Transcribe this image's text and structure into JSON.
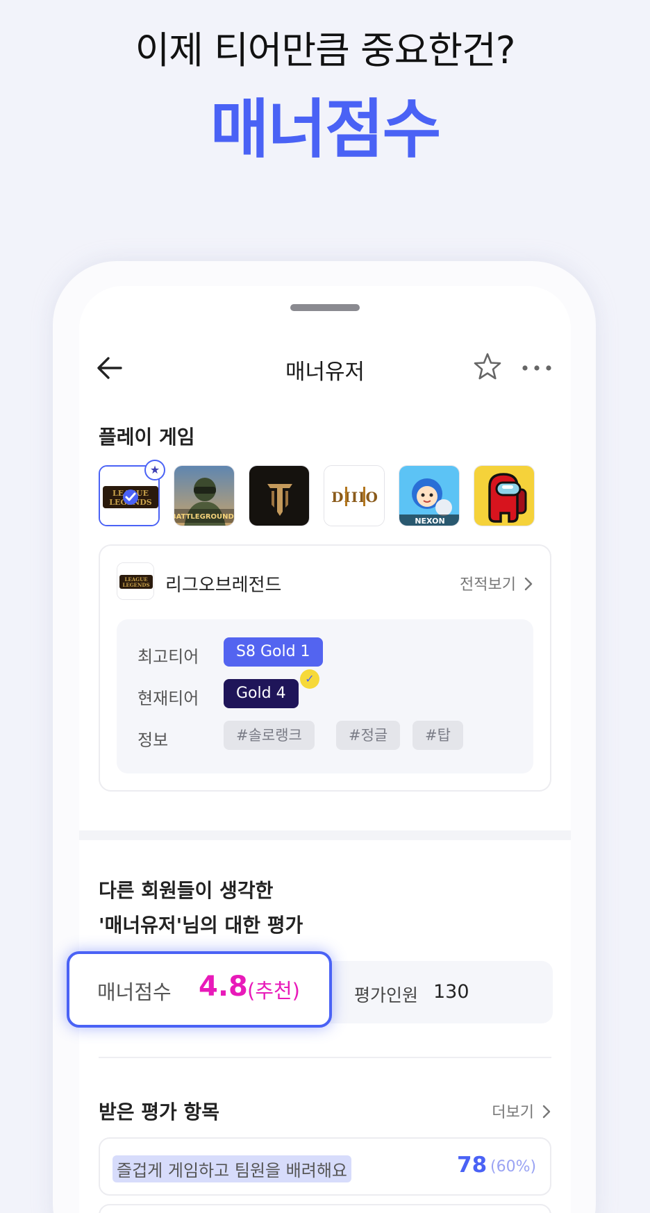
{
  "headline": "이제 티어만큼 중요한건?",
  "hero": "매너점수",
  "topbar": {
    "title": "매너유저"
  },
  "play_games": {
    "label": "플레이 게임",
    "games": [
      {
        "name": "League of Legends",
        "selected": true,
        "favorite": true
      },
      {
        "name": "PUBG: BATTLEGROUNDS"
      },
      {
        "name": "Lineage"
      },
      {
        "name": "Diablo II"
      },
      {
        "name": "Crazy Arcade (NEXON)"
      },
      {
        "name": "Among Us"
      }
    ]
  },
  "game_card": {
    "name": "리그오브레전드",
    "record_link": "전적보기",
    "best_tier_label": "최고티어",
    "best_tier": "S8 Gold 1",
    "current_tier_label": "현재티어",
    "current_tier": "Gold 4",
    "info_label": "정보",
    "tags": [
      "#솔로랭크",
      "#정글",
      "#탑"
    ]
  },
  "evaluation": {
    "title_line1": "다른 회원들이 생각한",
    "title_line2": "'매너유저'님의 대한 평가",
    "score_label": "매너점수",
    "score_value": "4.8",
    "score_note": "(추천)",
    "count_label": "평가인원",
    "count_value": "130"
  },
  "received": {
    "title": "받은 평가 항목",
    "more": "더보기",
    "items": [
      {
        "text": "즐겁게 게임하고 팀원을 배려해요",
        "count": "78",
        "pct": "(60%)"
      }
    ]
  },
  "colors": {
    "accent": "#4a62f5",
    "score": "#e81ab9",
    "current_tier_bg": "#1f1559",
    "background": "#f2f3fa"
  }
}
